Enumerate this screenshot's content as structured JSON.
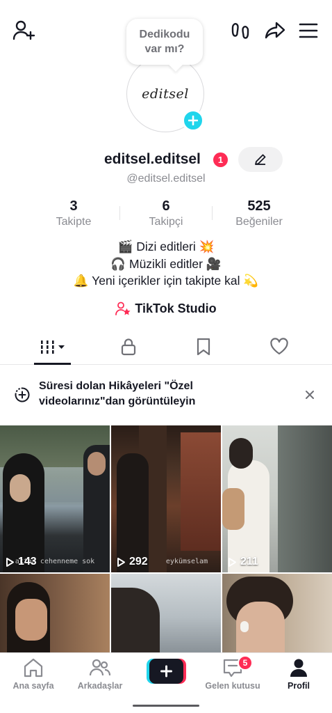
{
  "header": {
    "add_friend_icon": "person-plus-icon",
    "footprint_icon": "footprint-icon",
    "share_icon": "share-arrow-icon",
    "menu_icon": "hamburger-menu-icon"
  },
  "bubble": {
    "line1": "Dedikodu",
    "line2": "var mı?"
  },
  "avatar": {
    "text": "editsel",
    "add_icon": "plus-icon"
  },
  "profile": {
    "display_name": "editsel.editsel",
    "badge_count": "1",
    "handle": "@editsel.editsel",
    "edit_icon": "pencil-icon"
  },
  "stats": [
    {
      "value": "3",
      "label": "Takipte"
    },
    {
      "value": "6",
      "label": "Takipçi"
    },
    {
      "value": "525",
      "label": "Beğeniler"
    }
  ],
  "bio": [
    "🎬 Dizi editleri 💥",
    "🎧 Müzikli editler 🎥",
    "🔔 Yeni içerikler için takipte kal 💫"
  ],
  "studio": {
    "label": "TikTok Studio",
    "icon": "studio-person-star-icon"
  },
  "tabs": [
    {
      "name": "videos",
      "icon": "grid-bars-icon",
      "active": true
    },
    {
      "name": "private",
      "icon": "lock-icon",
      "active": false
    },
    {
      "name": "saved",
      "icon": "bookmark-icon",
      "active": false
    },
    {
      "name": "liked",
      "icon": "heart-icon",
      "active": false
    }
  ],
  "banner": {
    "text": "Süresi dolan Hikâyeleri \"Özel videolarınız\"dan görüntüleyin",
    "icon": "story-plus-icon",
    "close_icon": "close-icon"
  },
  "videos": [
    {
      "views": "143",
      "caption": "aktan cehenneme sok"
    },
    {
      "views": "292",
      "caption": "eykümselam"
    },
    {
      "views": "211",
      "caption": ""
    },
    {
      "views": "",
      "caption": ""
    },
    {
      "views": "",
      "caption": ""
    },
    {
      "views": "",
      "caption": ""
    }
  ],
  "bottom_nav": {
    "items": [
      {
        "label": "Ana sayfa",
        "icon": "home-icon"
      },
      {
        "label": "Arkadaşlar",
        "icon": "friends-icon"
      },
      {
        "label": "",
        "icon": "create-plus-icon"
      },
      {
        "label": "Gelen kutusu",
        "icon": "inbox-icon"
      },
      {
        "label": "Profil",
        "icon": "profile-icon"
      }
    ],
    "inbox_badge": "5"
  },
  "colors": {
    "accent_red": "#fe2c55",
    "accent_cyan": "#20d5ec",
    "text_primary": "#161823",
    "text_secondary": "#8a8b91"
  }
}
